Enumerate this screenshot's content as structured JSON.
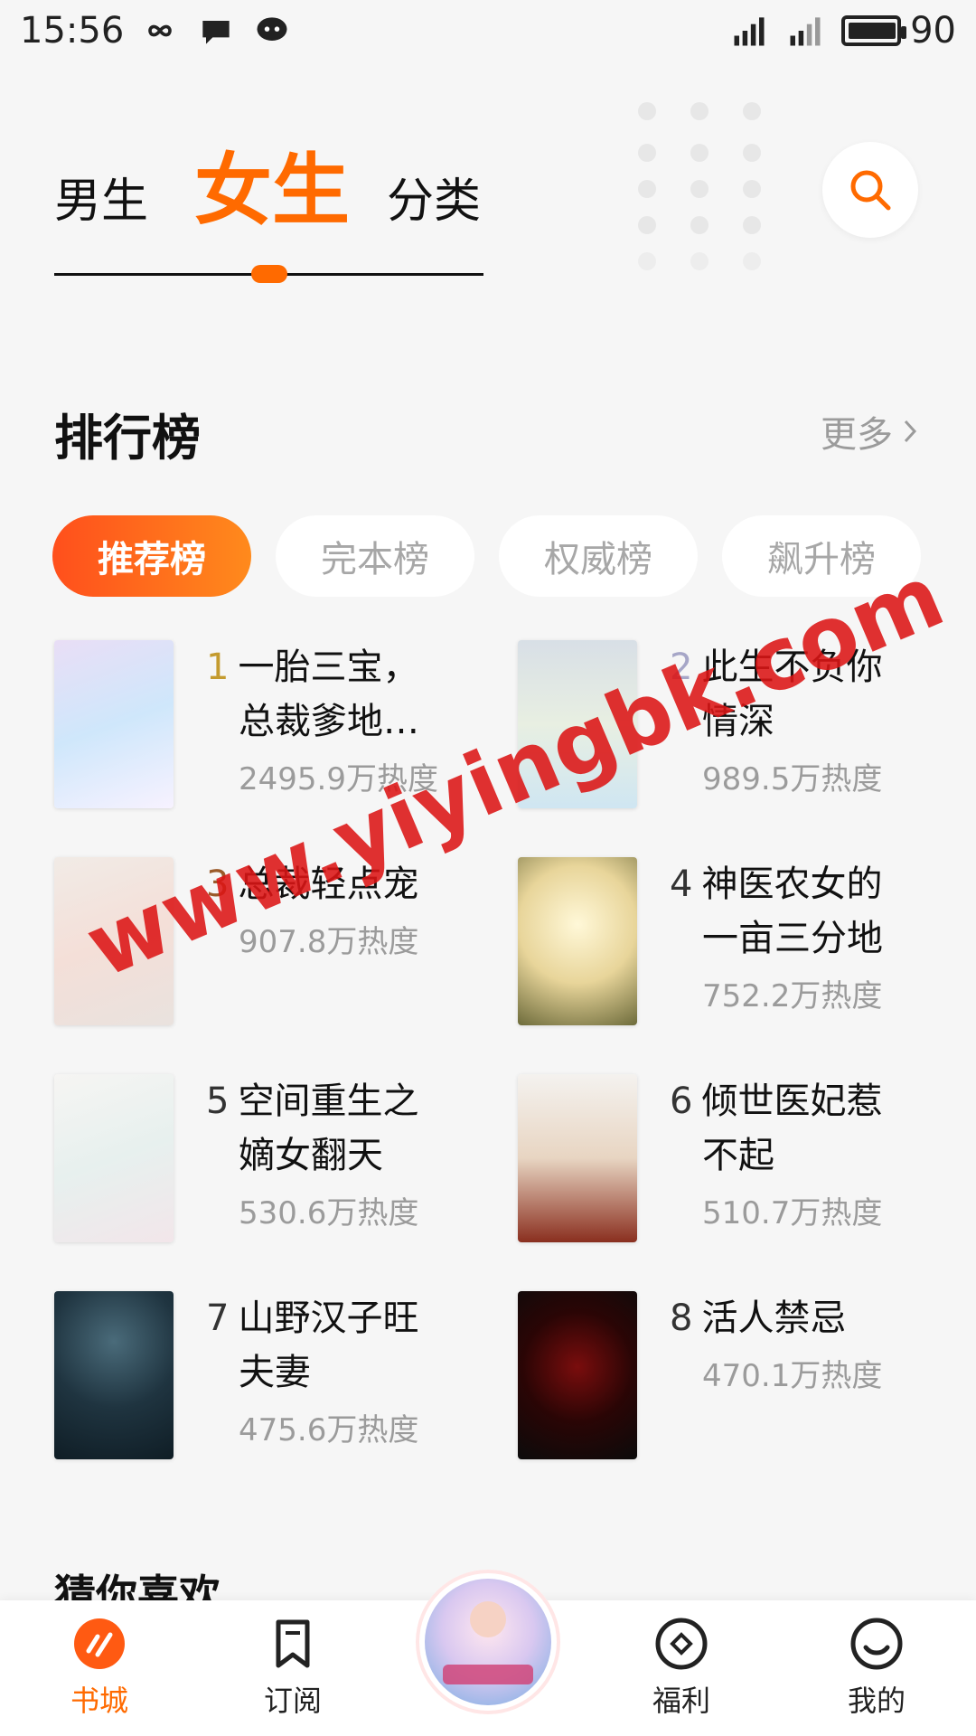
{
  "status_bar": {
    "time": "15:56",
    "battery": "90",
    "battery_level": 0.9
  },
  "header": {
    "tabs": [
      "男生",
      "女生",
      "分类"
    ],
    "active_tab": "女生"
  },
  "ranking": {
    "title": "排行榜",
    "more": "更多",
    "pills": [
      "推荐榜",
      "完本榜",
      "权威榜",
      "飙升榜"
    ],
    "active_pill": "推荐榜",
    "books": [
      {
        "rank": "1",
        "title": "一胎三宝，",
        "subtitle": "总裁爹地…",
        "heat": "2495.9万热度"
      },
      {
        "rank": "2",
        "title": "此生不负你",
        "subtitle": "情深",
        "heat": "989.5万热度"
      },
      {
        "rank": "3",
        "title": "总裁轻点宠",
        "subtitle": "",
        "heat": "907.8万热度"
      },
      {
        "rank": "4",
        "title": "神医农女的",
        "subtitle": "一亩三分地",
        "heat": "752.2万热度"
      },
      {
        "rank": "5",
        "title": "空间重生之",
        "subtitle": "嫡女翻天",
        "heat": "530.6万热度"
      },
      {
        "rank": "6",
        "title": "倾世医妃惹",
        "subtitle": "不起",
        "heat": "510.7万热度"
      },
      {
        "rank": "7",
        "title": "山野汉子旺",
        "subtitle": "夫妻",
        "heat": "475.6万热度"
      },
      {
        "rank": "8",
        "title": "活人禁忌",
        "subtitle": "",
        "heat": "470.1万热度"
      }
    ]
  },
  "guess": {
    "title": "猜你喜欢"
  },
  "bottom_nav": {
    "items": [
      "书城",
      "订阅",
      "福利",
      "我的"
    ],
    "active": "书城"
  },
  "watermark": "www.yiyingbk.com",
  "colors": {
    "accent": "#ff6a00",
    "muted": "#9b9b9b",
    "watermark": "#dc1414"
  },
  "icons": {
    "search": "search-icon",
    "more": "chevron-right-icon",
    "nav": [
      "bookstore-icon",
      "subscribe-icon",
      "welfare-icon",
      "profile-icon"
    ]
  }
}
